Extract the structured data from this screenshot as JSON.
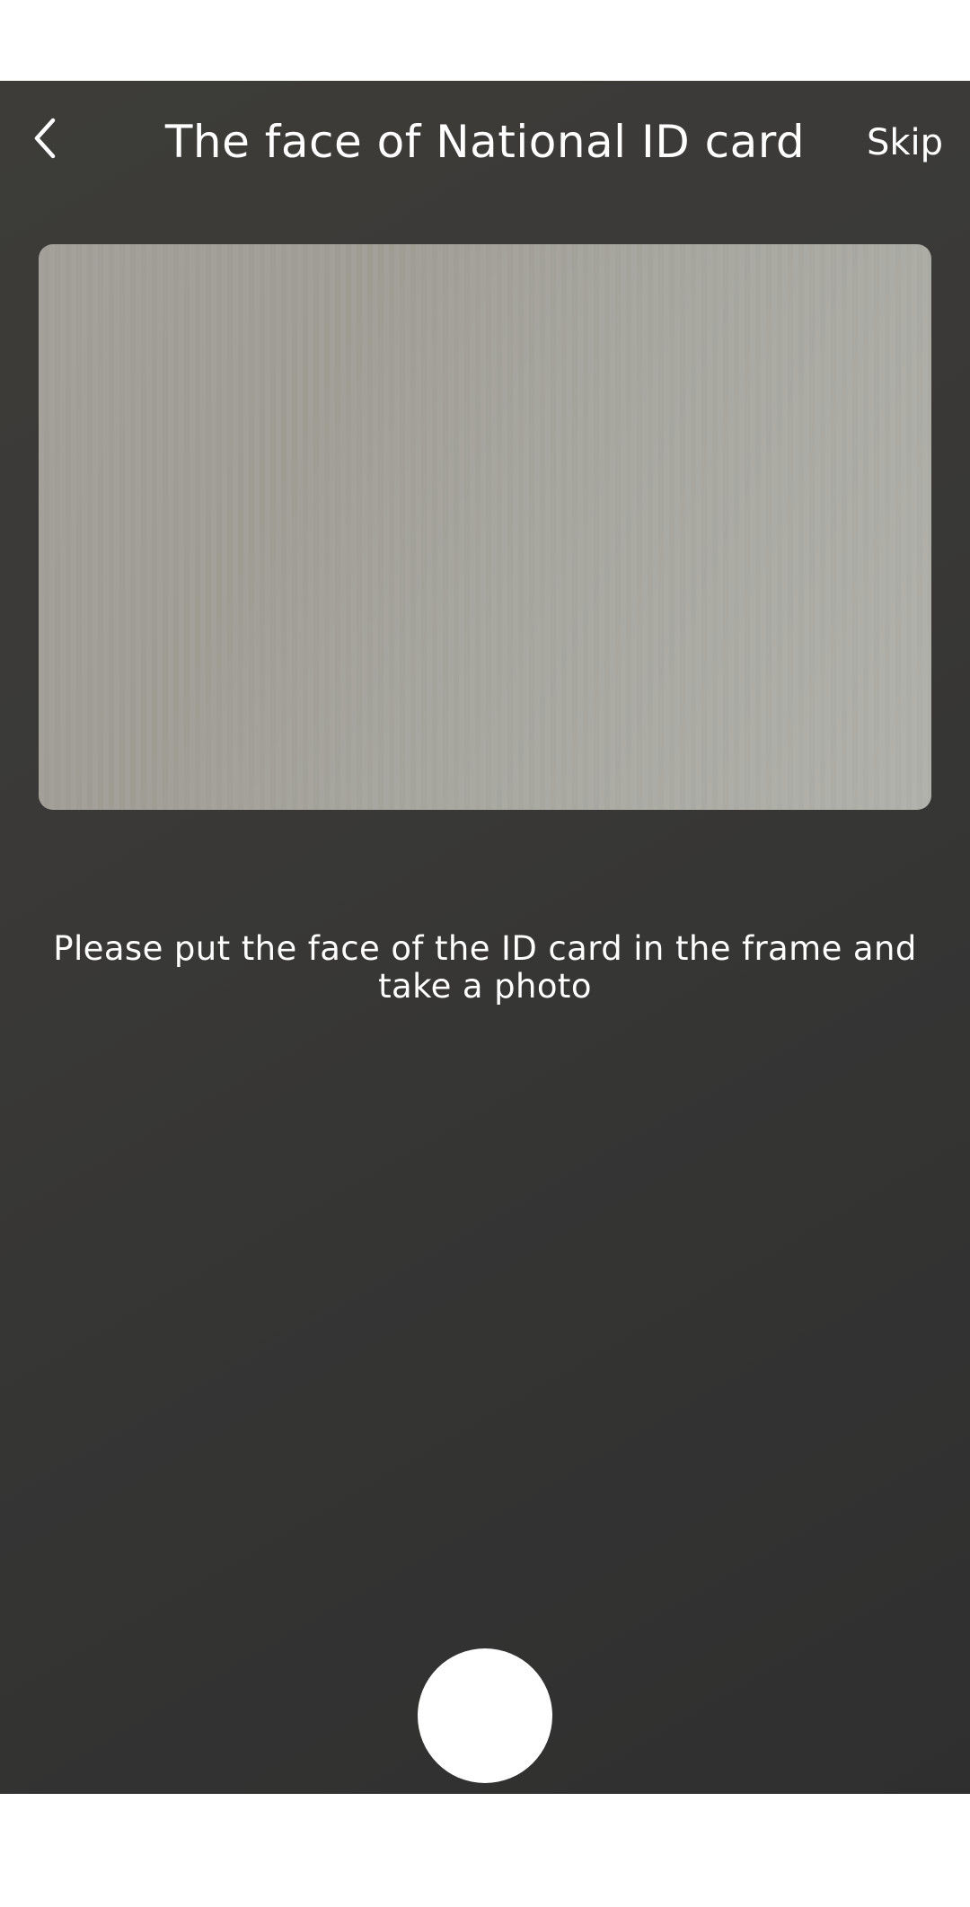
{
  "header": {
    "back_icon": "chevron-left-icon",
    "title": "The face of National ID card",
    "skip_label": "Skip"
  },
  "viewfinder": {
    "instruction": "Please put the face of the ID card in the frame and take a photo"
  },
  "controls": {
    "shutter_icon": "shutter-circle"
  },
  "colors": {
    "overlay": "#3a3937",
    "frame": "#a8a69f",
    "text": "#ffffff",
    "shutter": "#ffffff"
  }
}
